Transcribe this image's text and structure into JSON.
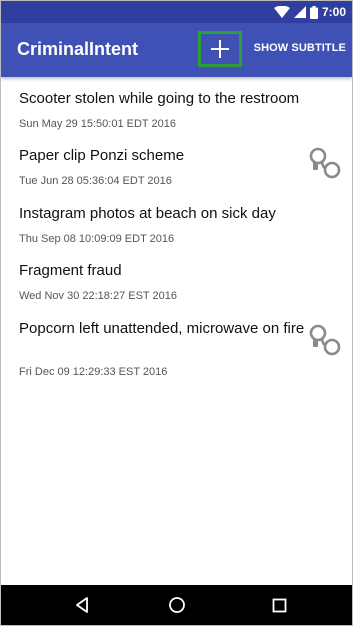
{
  "status_bar": {
    "time": "7:00",
    "icons": [
      "wifi-icon",
      "signal-icon",
      "battery-icon"
    ]
  },
  "app_bar": {
    "title": "CriminalIntent",
    "add_icon": "plus-icon",
    "subtitle_button": "SHOW SUBTITLE",
    "highlight_color": "#2e9e3a"
  },
  "crimes": [
    {
      "title": "Scooter stolen while going to the restroom",
      "date": "Sun May 29 15:50:01 EDT 2016",
      "solved": false
    },
    {
      "title": "Paper clip Ponzi scheme",
      "date": "Tue Jun 28 05:36:04 EDT 2016",
      "solved": true
    },
    {
      "title": "Instagram photos at beach on sick day",
      "date": "Thu Sep 08 10:09:09 EDT 2016",
      "solved": false
    },
    {
      "title": "Fragment fraud",
      "date": "Wed Nov 30 22:18:27 EST 2016",
      "solved": false
    },
    {
      "title": "Popcorn left unattended, microwave on fire",
      "date": "Fri Dec 09 12:29:33 EST 2016",
      "solved": true
    }
  ],
  "nav_bar": {
    "buttons": [
      "back-icon",
      "home-icon",
      "recents-icon"
    ]
  },
  "colors": {
    "status_bar": "#303f9f",
    "app_bar": "#3f51b5",
    "nav_bar": "#000000"
  }
}
